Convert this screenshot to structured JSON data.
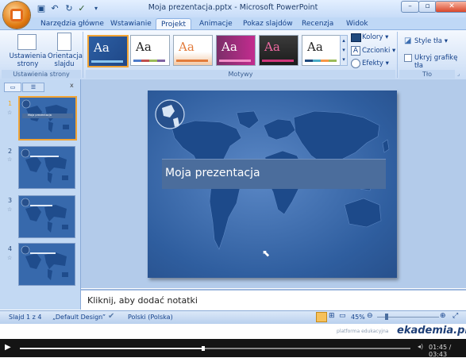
{
  "window": {
    "title": "Moja prezentacja.pptx - Microsoft PowerPoint"
  },
  "tabs": [
    "Narzędzia główne",
    "Wstawianie",
    "Projekt",
    "Animacje",
    "Pokaz slajdów",
    "Recenzja",
    "Widok"
  ],
  "ribbon": {
    "page_setup": {
      "setup_label": "Ustawienia strony",
      "orientation_label": "Orientacja slajdu",
      "group_label": "Ustawienia strony"
    },
    "themes": {
      "group_label": "Motywy",
      "theme_text": "Aa"
    },
    "theme_options": {
      "colors": "Kolory",
      "fonts": "Czcionki",
      "effects": "Efekty"
    },
    "background": {
      "styles": "Style tła",
      "hide_graphics": "Ukryj grafikę tła",
      "group_label": "Tło"
    }
  },
  "slides": [
    {
      "number": "1",
      "title": "Moja prezentacja"
    },
    {
      "number": "2",
      "title": ""
    },
    {
      "number": "3",
      "title": ""
    },
    {
      "number": "4",
      "title": ""
    }
  ],
  "main_slide": {
    "title": "Moja prezentacja"
  },
  "notes": {
    "placeholder": "Kliknij, aby dodać notatki"
  },
  "status": {
    "slide": "Slajd 1 z 4",
    "theme": "„Default Design”",
    "language": "Polski (Polska)",
    "zoom": "45%"
  },
  "watermark": {
    "tagline": "platforma edukacyjna",
    "brand": "ekademia.pl"
  },
  "player": {
    "time": "01:45 / 03:43",
    "progress": 0.47
  },
  "colors": {
    "accent": "#f1a436",
    "ribbon": "#dde9f9",
    "slide_bg": "#2f5e9f"
  }
}
